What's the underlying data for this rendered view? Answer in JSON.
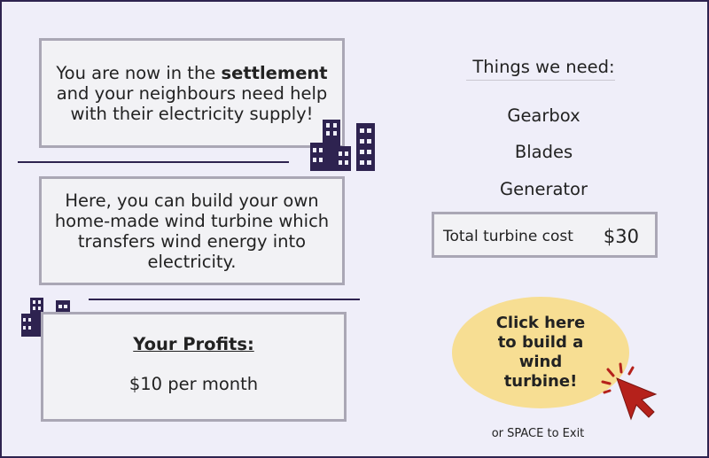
{
  "intro": {
    "before": "You are now in the ",
    "keyword": "settlement",
    "after": " and your neighbours need help with their electricity supply!"
  },
  "build_info": "Here, you can build your own home-made wind turbine which transfers wind energy into electricity.",
  "profits": {
    "title": "Your Profits:",
    "value": "$10 per month"
  },
  "needs": {
    "title": "Things we need:",
    "items": [
      "Gearbox",
      "Blades",
      "Generator"
    ]
  },
  "cost": {
    "label": "Total turbine cost",
    "value": "$30"
  },
  "build_button": "Click here to build a wind turbine!",
  "exit_hint": "or SPACE to Exit",
  "colors": {
    "frame": "#2e2350",
    "building": "#2e2350",
    "button": "#f7de93",
    "cursor": "#b5211b"
  },
  "icons": [
    "city-buildings-icon",
    "cursor-click-icon"
  ]
}
